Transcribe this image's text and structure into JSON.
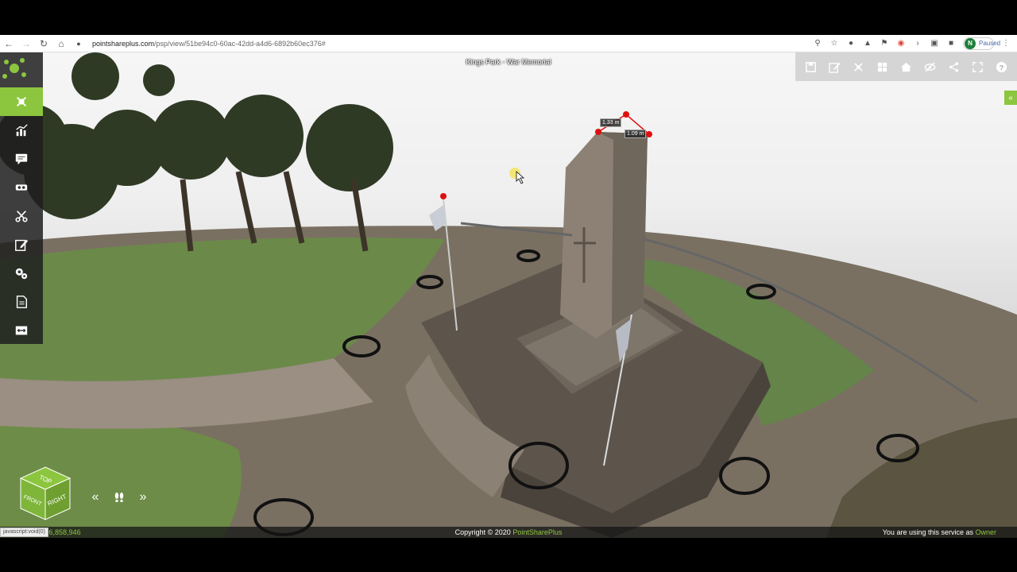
{
  "browser": {
    "url_host": "pointshareplus.com",
    "url_path": "/psp/view/51be94c0-60ac-42dd-a4d6-6892b60ec376#",
    "profile_initial": "N",
    "profile_status": "Paused"
  },
  "viewer": {
    "title": "Kings Park - War Memorial",
    "measurements": [
      "1.33 m",
      "1.09 m"
    ]
  },
  "footer": {
    "point_count": "nt number: 106,858,946",
    "copyright": "Copyright © 2020 ",
    "brand": "PointSharePlus",
    "role_prefix": "You are using this service as ",
    "role": "Owner",
    "status_tip": "javascript:void(0)"
  },
  "cube": {
    "top": "TOP",
    "front": "FRONT",
    "right": "RIGHT"
  },
  "colors": {
    "accent": "#8cc63f",
    "toolbar": "#1e1e1e"
  },
  "icons": {
    "left_toolbar": [
      "satellite-icon",
      "chart-icon",
      "comment-settings-icon",
      "vr-headset-icon",
      "scissors-icon",
      "edit-icon",
      "gears-icon",
      "document-icon",
      "swap-icon"
    ],
    "right_toolbar": [
      "save-icon",
      "edit-icon",
      "satellite-icon",
      "windows-icon",
      "home-icon",
      "visibility-off-icon",
      "share-icon",
      "fullscreen-icon",
      "help-icon"
    ]
  }
}
